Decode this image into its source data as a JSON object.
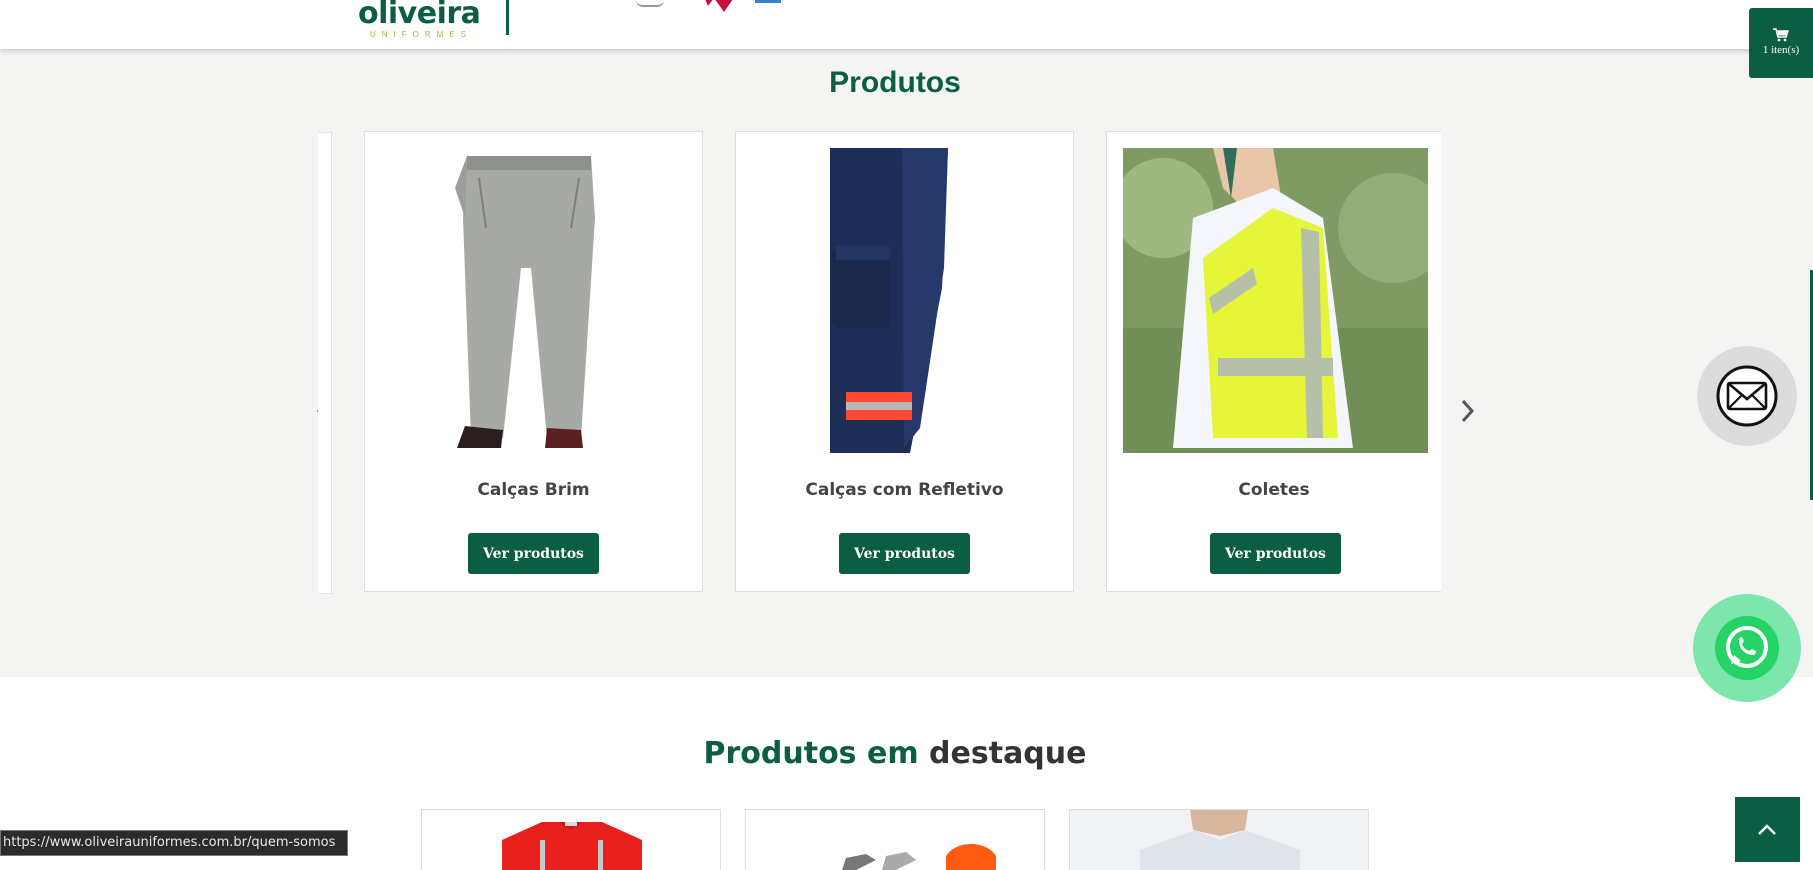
{
  "header": {
    "logo_text": "oliveira",
    "logo_subtitle": "UNIFORMES"
  },
  "cart": {
    "label": "1 iten(s)",
    "icon": "cart-icon"
  },
  "products": {
    "title": "Produtos",
    "items": [
      {
        "name": "Calças Brim",
        "button_label": "Ver produtos",
        "image": "grey-work-pants"
      },
      {
        "name": "Calças com Refletivo",
        "button_label": "Ver produtos",
        "image": "navy-pants-with-reflective-stripe"
      },
      {
        "name": "Coletes",
        "button_label": "Ver produtos",
        "image": "yellow-reflective-vest"
      }
    ],
    "prev_icon": "chevron-left-icon",
    "next_icon": "chevron-right-icon"
  },
  "featured": {
    "title_accent": "Produtos em",
    "title_rest": "destaque"
  },
  "floating": {
    "mail_icon": "mail-icon",
    "whatsapp_icon": "whatsapp-icon",
    "back_to_top_icon": "chevron-up-icon"
  },
  "status_bar": {
    "url": "https://www.oliveirauniformes.com.br/quem-somos"
  },
  "colors": {
    "brand_green": "#0b5d44",
    "logo_accent": "#8cc63f",
    "section_bg": "#f4f4f2",
    "whatsapp_green": "#25d366"
  }
}
